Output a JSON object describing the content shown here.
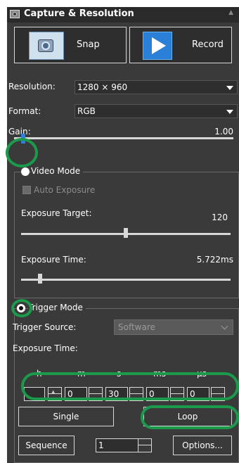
{
  "panel": {
    "title": "Capture & Resolution"
  },
  "buttons": {
    "snap": "Snap",
    "record": "Record"
  },
  "resolution": {
    "label": "Resolution:",
    "value": "1280 × 960"
  },
  "format": {
    "label": "Format:",
    "value": "RGB"
  },
  "gain": {
    "label": "Gain:",
    "value": "1.00",
    "level": 0.0
  },
  "video_mode": {
    "label": "Video Mode",
    "selected": false,
    "auto_exposure": "Auto Exposure",
    "auto_exposure_checked": false,
    "exposure_target": {
      "label": "Exposure Target:",
      "value": "120",
      "level": 0.5
    },
    "exposure_time": {
      "label": "Exposure Time:",
      "value": "5.722ms",
      "level": 0.1
    }
  },
  "trigger_mode": {
    "label": "Trigger Mode",
    "selected": true,
    "trigger_source_label": "Trigger Source:",
    "trigger_source_value": "Software",
    "exposure_time_label": "Exposure Time:",
    "units": [
      "h",
      "m",
      "s",
      "ms",
      "µs"
    ],
    "fields": [
      "",
      "0",
      "30",
      "0",
      "0"
    ]
  },
  "actions": {
    "single": "Single",
    "loop": "Loop",
    "sequence": "Sequence",
    "sequence_count": "1",
    "options": "Options..."
  },
  "colors": {
    "panel_bg": "#3a3a3a",
    "highlight": "#1a9a4a"
  }
}
